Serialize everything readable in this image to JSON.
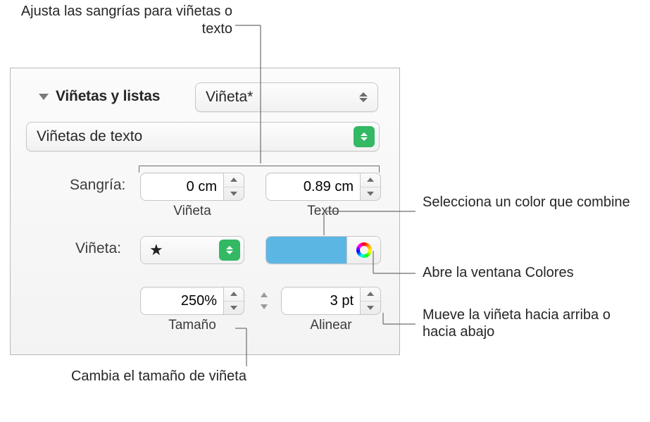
{
  "callouts": {
    "top": "Ajusta las sangrías para viñetas o texto",
    "right_color": "Selecciona un color que combine",
    "right_colorwell": "Abre la ventana Colores",
    "right_align": "Mueve la viñeta hacia arriba o hacia abajo",
    "bottom_size": "Cambia el tamaño de viñeta"
  },
  "panel": {
    "section_title": "Viñetas y listas",
    "style_dropdown": "Viñeta*",
    "type_dropdown": "Viñetas de texto",
    "indent_label": "Sangría:",
    "indent_bullet_value": "0 cm",
    "indent_text_value": "0.89 cm",
    "sublabel_bullet": "Viñeta",
    "sublabel_text": "Texto",
    "bullet_label": "Viñeta:",
    "bullet_symbol": "★",
    "size_value": "250%",
    "sublabel_size": "Tamaño",
    "align_value": "3 pt",
    "sublabel_align": "Alinear"
  },
  "colors": {
    "swatch": "#5cb6e4",
    "accent_green": "#33b864"
  }
}
